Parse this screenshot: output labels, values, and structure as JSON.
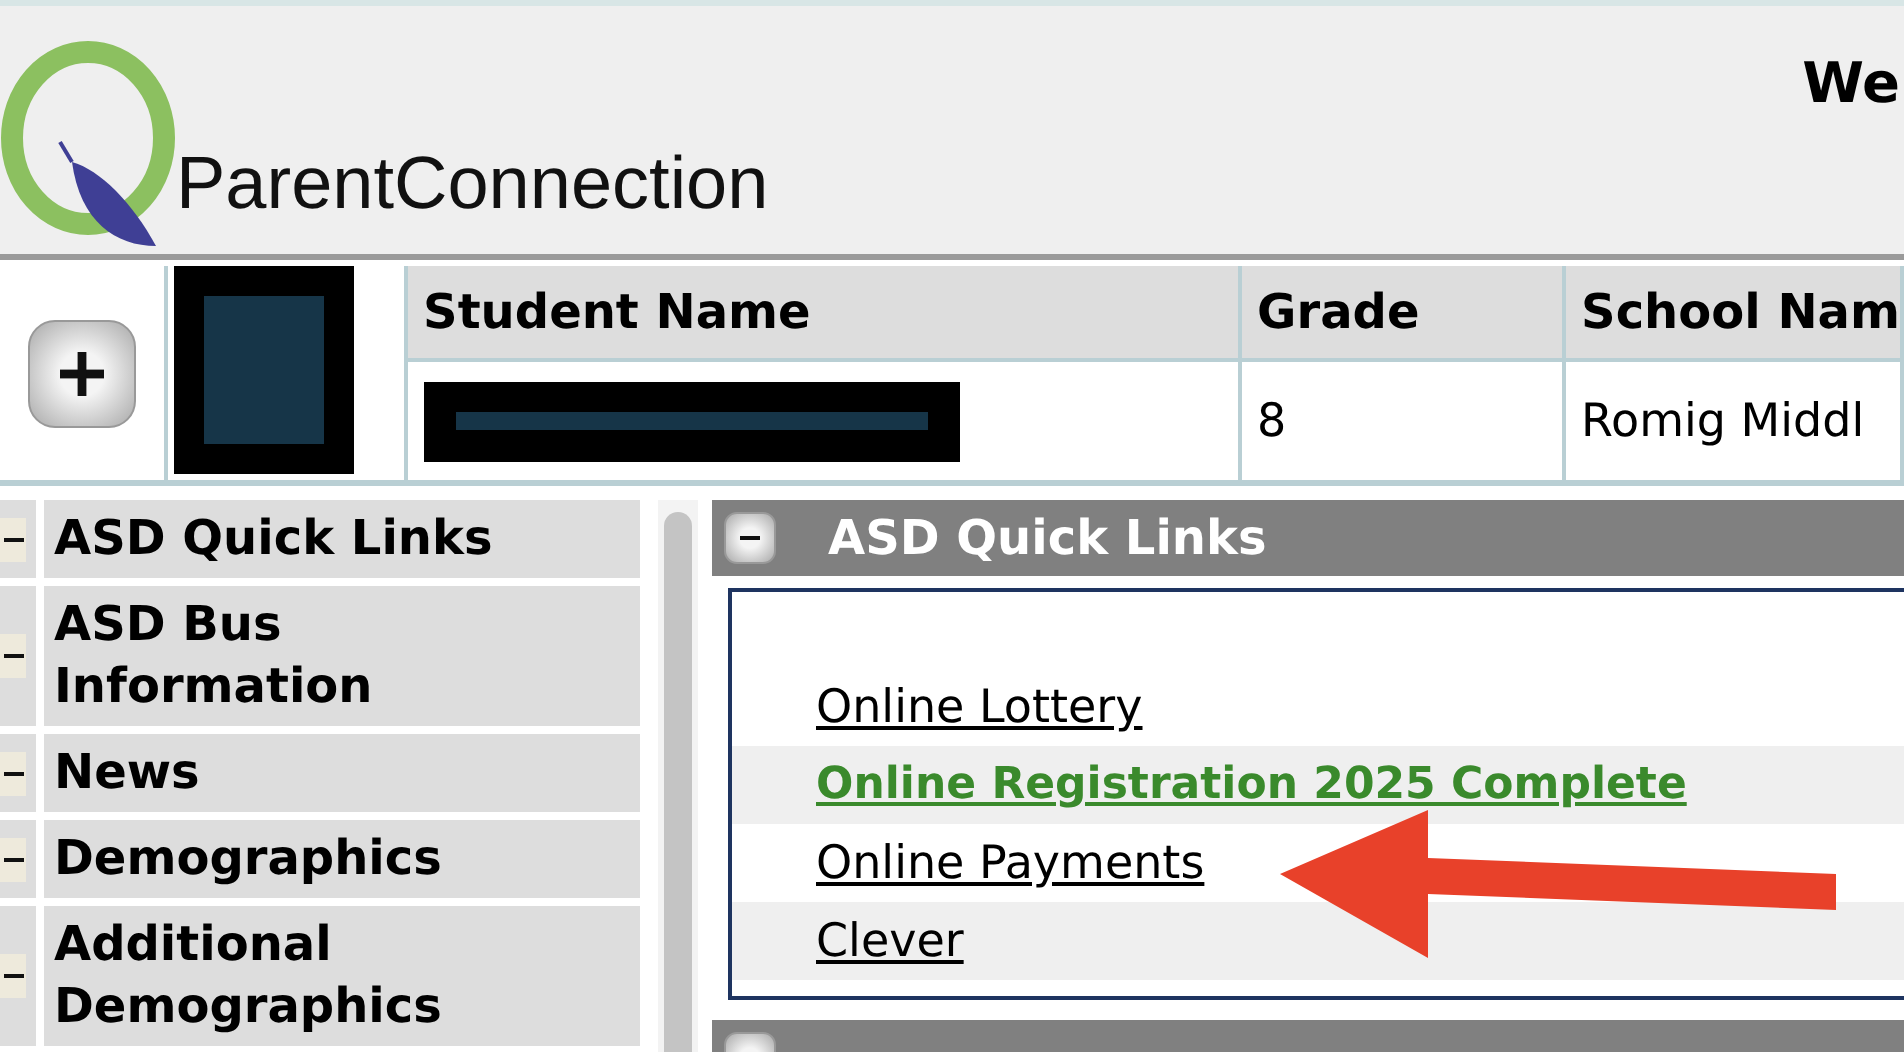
{
  "header": {
    "logo_text": "ParentConnection",
    "greeting": "We"
  },
  "student_table": {
    "expanded": false,
    "columns": [
      "Student Name",
      "Grade",
      "School Nam"
    ],
    "rows": [
      {
        "grade": "8",
        "school": "Romig Middl"
      }
    ]
  },
  "sidebar": {
    "items": [
      {
        "label": "ASD Quick Links",
        "expanded": true
      },
      {
        "label": "ASD Bus Information",
        "expanded": true
      },
      {
        "label": "News",
        "expanded": true
      },
      {
        "label": "Demographics",
        "expanded": true
      },
      {
        "label": "Additional Demographics",
        "expanded": true
      }
    ]
  },
  "panels": [
    {
      "title": "ASD Quick Links",
      "expanded": true,
      "links": [
        {
          "label": "Online Lottery",
          "highlighted": false
        },
        {
          "label": "Online Registration 2025 Complete",
          "highlighted": true
        },
        {
          "label": "Online Payments",
          "highlighted": false
        },
        {
          "label": "Clever",
          "highlighted": false
        }
      ]
    },
    {
      "kind": "collapsed-header"
    }
  ]
}
